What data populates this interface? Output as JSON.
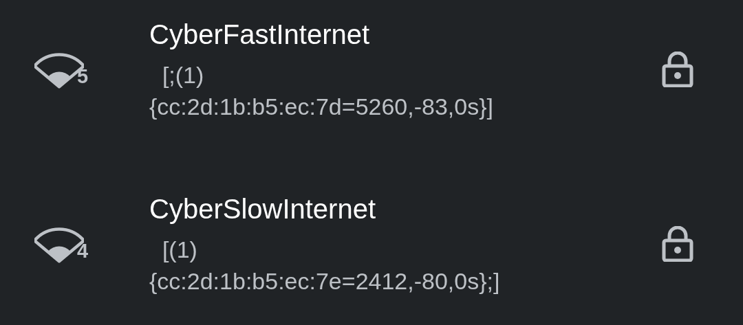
{
  "networks": [
    {
      "name": "CyberFastInternet",
      "band": "5",
      "details": [
        "  [;(1)",
        "{cc:2d:1b:b5:ec:7d=5260,-83,0s}]"
      ],
      "secured": true
    },
    {
      "name": "CyberSlowInternet",
      "band": "4",
      "details": [
        "  [(1)",
        "{cc:2d:1b:b5:ec:7e=2412,-80,0s};]"
      ],
      "secured": true
    }
  ]
}
